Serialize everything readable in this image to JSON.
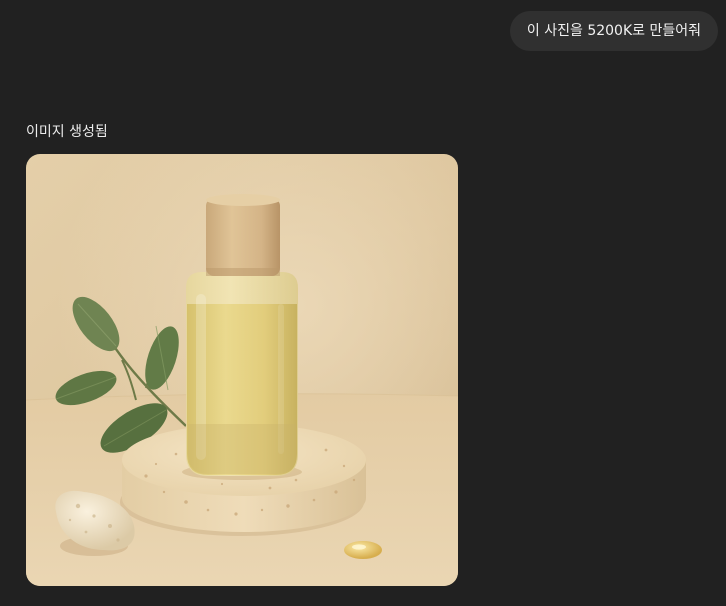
{
  "user_message": {
    "text": "이 사진을 5200K로 만들어줘"
  },
  "assistant": {
    "status_label": "이미지 생성됨",
    "image": {
      "alt": "Amber glass dropper bottle on a speckled stone pedestal with eucalyptus leaves, a pebble and a droplet"
    }
  },
  "colors": {
    "background": "#212121",
    "bubble": "#303030",
    "text": "#ececec"
  }
}
